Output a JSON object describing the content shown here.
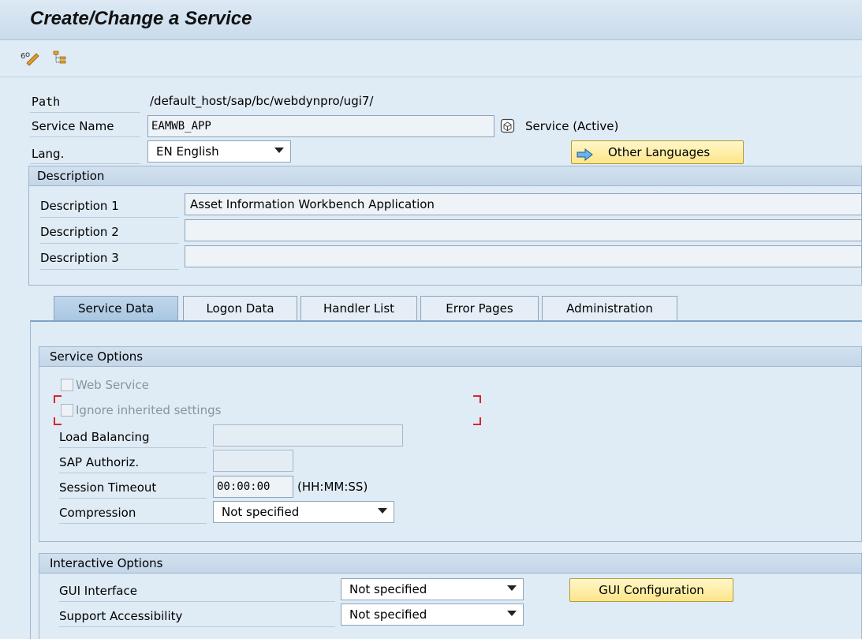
{
  "title": "Create/Change a Service",
  "toolbar": {
    "icons": [
      "display-change-icon",
      "hierarchy-icon"
    ]
  },
  "header": {
    "path_label": "Path",
    "path_value": "/default_host/sap/bc/webdynpro/ugi7/",
    "service_name_label": "Service Name",
    "service_name_value": "EAMWB_APP",
    "service_status": "Service (Active)",
    "lang_label": "Lang.",
    "lang_value": "EN English",
    "other_languages_button": "Other Languages"
  },
  "description": {
    "title": "Description",
    "rows": [
      {
        "label": "Description 1",
        "value": "Asset Information Workbench Application"
      },
      {
        "label": "Description 2",
        "value": ""
      },
      {
        "label": "Description 3",
        "value": ""
      }
    ]
  },
  "tabs": [
    {
      "label": "Service Data",
      "active": true
    },
    {
      "label": "Logon Data",
      "active": false
    },
    {
      "label": "Handler List",
      "active": false
    },
    {
      "label": "Error Pages",
      "active": false
    },
    {
      "label": "Administration",
      "active": false
    }
  ],
  "service_options": {
    "title": "Service Options",
    "web_service": {
      "label": "Web Service",
      "checked": false,
      "enabled": false
    },
    "ignore_inherited": {
      "label": "Ignore inherited settings",
      "checked": false,
      "enabled": false
    },
    "load_balancing": {
      "label": "Load Balancing",
      "value": ""
    },
    "sap_authoriz": {
      "label": "SAP Authoriz.",
      "value": ""
    },
    "session_timeout": {
      "label": "Session Timeout",
      "value": "00:00:00",
      "unit": "(HH:MM:SS)"
    },
    "compression": {
      "label": "Compression",
      "value": "Not specified"
    }
  },
  "interactive_options": {
    "title": "Interactive Options",
    "gui_interface": {
      "label": "GUI Interface",
      "value": "Not specified"
    },
    "support_accessibility": {
      "label": "Support Accessibility",
      "value": "Not specified"
    },
    "gui_configuration_button": "GUI Configuration"
  },
  "colors": {
    "background": "#dfebf5",
    "button_yellow": "#fce58a",
    "active_tab": "#a8c6e2",
    "focus_corner": "#d9262c"
  }
}
